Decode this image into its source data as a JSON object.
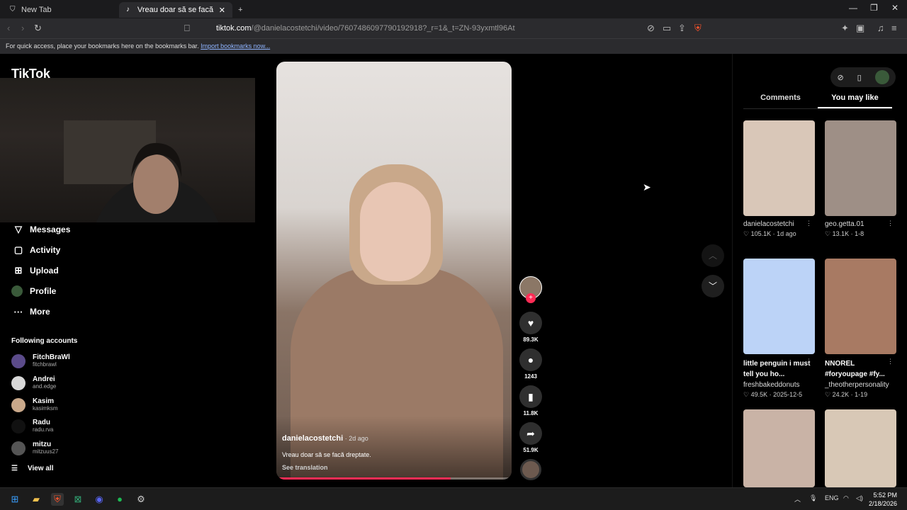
{
  "browser": {
    "tabs": [
      {
        "label": "New Tab",
        "active": false
      },
      {
        "label": "Vreau doar să se facă dreptat",
        "active": true
      }
    ],
    "new_tab": "+",
    "url_host": "tiktok.com",
    "url_path": "/@danielacostetchi/video/7607486097790192918?_r=1&_t=ZN-93yxmtl96At",
    "bookmarks_text": "For quick access, place your bookmarks here on the bookmarks bar.",
    "bookmarks_link": "Import bookmarks now..."
  },
  "sidebar": {
    "logo": "TikTok",
    "nav": [
      {
        "label": "Messages",
        "icon": "send-icon"
      },
      {
        "label": "Activity",
        "icon": "activity-icon"
      },
      {
        "label": "Upload",
        "icon": "upload-icon"
      },
      {
        "label": "Profile",
        "icon": "profile-icon"
      },
      {
        "label": "More",
        "icon": "more-icon"
      }
    ],
    "following_title": "Following accounts",
    "accounts": [
      {
        "name": "FitchBraWl",
        "handle": "fitchbrawl",
        "color": "#5b4b8a"
      },
      {
        "name": "Andrei",
        "handle": "and.edge",
        "color": "#d8d8d8"
      },
      {
        "name": "Kasim",
        "handle": "kasimksm",
        "color": "#c9a88a"
      },
      {
        "name": "Radu",
        "handle": "radu.rva",
        "color": "#111111"
      },
      {
        "name": "mitzu",
        "handle": "mitzuus27",
        "color": "#555555"
      }
    ],
    "view_all": "View all"
  },
  "video": {
    "author": "danielacostetchi",
    "ago": " · 2d ago",
    "caption": "Vreau doar să se facă dreptate.",
    "see_translation": "See translation",
    "progress": 0.74
  },
  "actions": {
    "likes": "89.3K",
    "comments": "1243",
    "saves": "11.8K",
    "shares": "51.9K"
  },
  "right_panel": {
    "tabs": [
      "Comments",
      "You may like"
    ],
    "active_tab": "You may like",
    "cards": [
      {
        "title": "danielacostetchi",
        "stat": "♡ 105.1K · 1d ago",
        "bold": false,
        "color": "#d9c7b8"
      },
      {
        "title": "geo.getta.01",
        "stat": "♡ 13.1K · 1-8",
        "bold": false,
        "color": "#9e8f86"
      },
      {
        "title": "little penguin i must tell you ho...",
        "sub": "freshbakeddonuts",
        "stat": "♡ 49.5K · 2025-12-5",
        "bold": true,
        "color": "#bcd3f7"
      },
      {
        "title": "NNOREL #foryoupage #fy...",
        "sub": "_theotherpersonality",
        "stat": "♡ 24.2K · 1-19",
        "bold": true,
        "color": "#a87a63"
      },
      {
        "title": "",
        "stat": "",
        "bold": false,
        "color": "#c9b3a6"
      },
      {
        "title": "",
        "stat": "",
        "bold": false,
        "color": "#d8c8b6"
      }
    ]
  },
  "taskbar": {
    "lang": "ENG",
    "time": "5:52 PM",
    "date": "2/18/2026"
  }
}
